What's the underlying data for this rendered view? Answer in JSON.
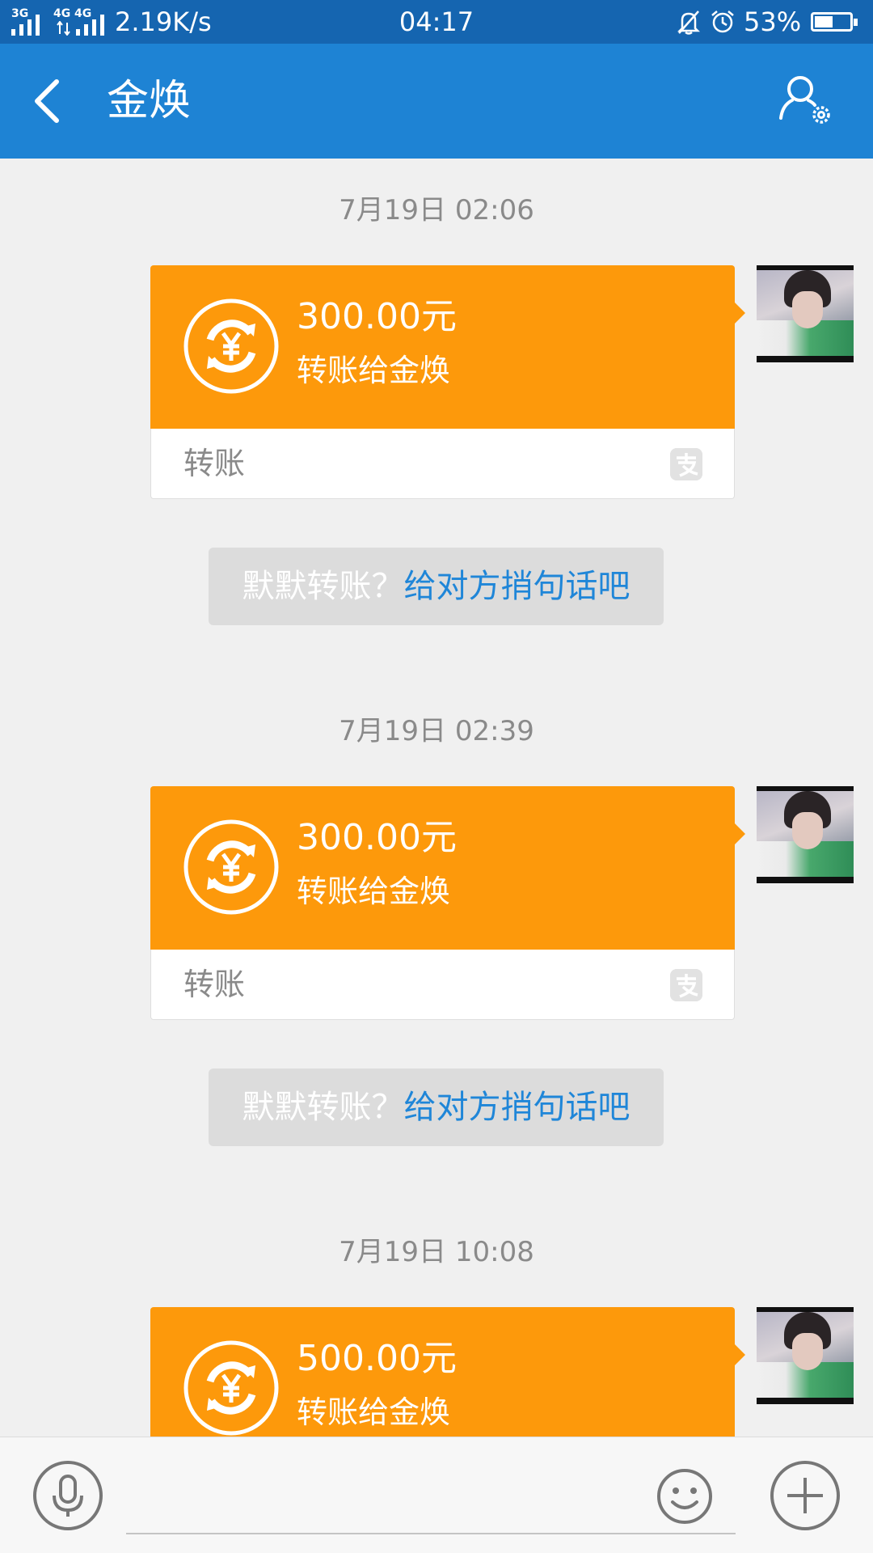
{
  "status_bar": {
    "network_1": "3G",
    "network_2": "4G",
    "network_3": "4G",
    "speed": "2.19K/s",
    "time": "04:17",
    "battery_percent": "53%",
    "battery_level": 0.53
  },
  "header": {
    "title": "金焕"
  },
  "messages": [
    {
      "timestamp": "7月19日 02:06",
      "amount": "300.00元",
      "description": "转账给金焕",
      "type_label": "转账",
      "hint_text": "默默转账？",
      "hint_link": "给对方捎句话吧"
    },
    {
      "timestamp": "7月19日 02:39",
      "amount": "300.00元",
      "description": "转账给金焕",
      "type_label": "转账",
      "hint_text": "默默转账？",
      "hint_link": "给对方捎句话吧"
    },
    {
      "timestamp": "7月19日 10:08",
      "amount": "500.00元",
      "description": "转账给金焕"
    }
  ],
  "input_bar": {
    "message_value": ""
  },
  "colors": {
    "status_bar": "#1565b0",
    "title_bar": "#1e83d4",
    "transfer_card": "#fd990b",
    "hint_link": "#1f86d8",
    "background": "#f0f0f0"
  },
  "icons": {
    "back": "chevron-left-icon",
    "profile_settings": "user-gear-icon",
    "transfer": "yuan-exchange-icon",
    "alipay": "alipay-icon",
    "voice": "microphone-icon",
    "emoji": "smiley-icon",
    "more": "plus-icon"
  }
}
